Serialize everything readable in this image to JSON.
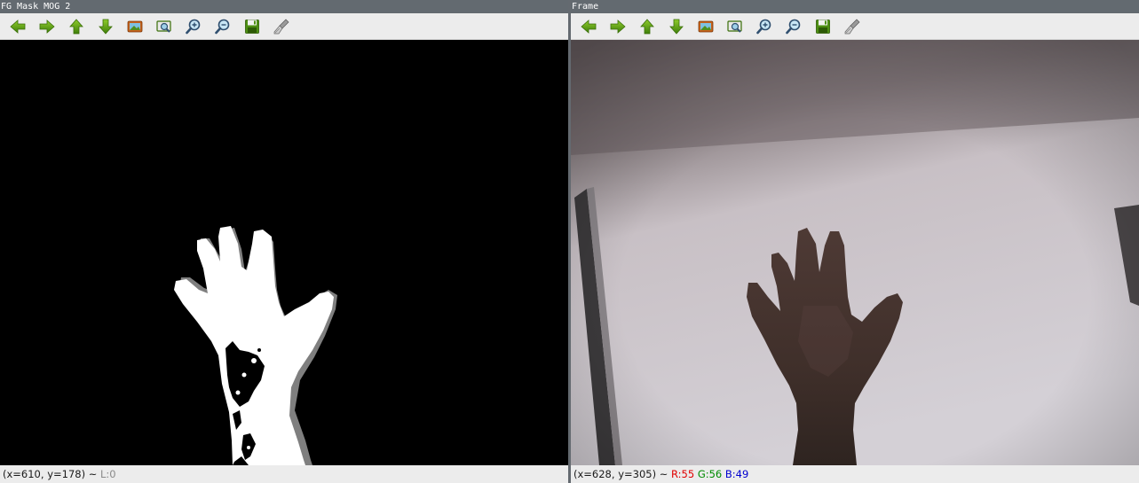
{
  "windows": {
    "left": {
      "title": "FG Mask MOG 2",
      "status": {
        "coords": "(x=610, y=178) ~",
        "value": "L:0"
      }
    },
    "right": {
      "title": "Frame",
      "status": {
        "coords": "(x=628, y=305) ~",
        "r": "R:55",
        "g": "G:56",
        "b": "B:49"
      }
    }
  },
  "toolbar": {
    "buttons": [
      {
        "name": "pan-left-icon"
      },
      {
        "name": "pan-right-icon"
      },
      {
        "name": "pan-up-icon"
      },
      {
        "name": "pan-down-icon"
      },
      {
        "name": "zoom-original-icon"
      },
      {
        "name": "zoom-fit-icon"
      },
      {
        "name": "zoom-in-icon"
      },
      {
        "name": "zoom-out-icon"
      },
      {
        "name": "save-icon"
      },
      {
        "name": "properties-icon"
      }
    ]
  },
  "colors": {
    "titlebar_bg": "#636a70",
    "toolbar_bg": "#ececec",
    "arrow_green": "#5a9a10",
    "mask_background": "#000000",
    "mask_foreground": "#ffffff",
    "mask_shadow": "#7f7f7f"
  }
}
